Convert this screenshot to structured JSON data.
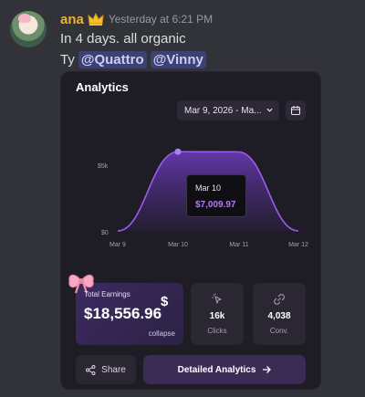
{
  "message": {
    "username": "ana",
    "timestamp": "Yesterday at 6:21 PM",
    "line1": "In 4 days. all organic",
    "line2_prefix": "Ty",
    "mentions": [
      "@Quattro",
      "@Vinny"
    ]
  },
  "card": {
    "title": "Analytics",
    "date_range": "Mar 9, 2026 - Ma...",
    "chart": {
      "y_ticks": [
        "$5k",
        "$0"
      ],
      "x_ticks": [
        "Mar 9",
        "Mar 10",
        "Mar 11",
        "Mar 12"
      ],
      "tooltip": {
        "date": "Mar 10",
        "value": "$7,009.97"
      }
    },
    "earnings": {
      "label": "Total Earnings",
      "value": "$18,556.96",
      "currency_symbol": "$",
      "collapse_label": "collapse"
    },
    "stats": [
      {
        "icon": "cursor-click-icon",
        "value": "16k",
        "label": "Clicks"
      },
      {
        "icon": "conversion-icon",
        "value": "4,038",
        "label": "Conv."
      }
    ],
    "share_label": "Share",
    "details_label": "Detailed Analytics"
  },
  "chart_data": {
    "type": "area",
    "x": [
      "Mar 9",
      "Mar 10",
      "Mar 11",
      "Mar 12"
    ],
    "series": [
      {
        "values": [
          0,
          7009.97,
          7000,
          0
        ]
      }
    ],
    "ylim": [
      0,
      8000
    ],
    "grid": false,
    "color": "#9b5cf0"
  },
  "colors": {
    "accent": "#9b5cf0",
    "username": "#f0b232",
    "mention_bg": "#5865f2"
  }
}
